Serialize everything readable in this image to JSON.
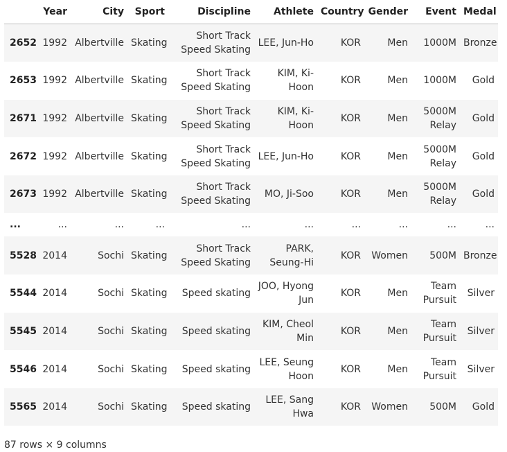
{
  "table": {
    "columns": [
      "",
      "Year",
      "City",
      "Sport",
      "Discipline",
      "Athlete",
      "Country",
      "Gender",
      "Event",
      "Medal"
    ],
    "rows": [
      [
        "2652",
        "1992",
        "Albertville",
        "Skating",
        "Short Track Speed Skating",
        "LEE, Jun-Ho",
        "KOR",
        "Men",
        "1000M",
        "Bronze"
      ],
      [
        "2653",
        "1992",
        "Albertville",
        "Skating",
        "Short Track Speed Skating",
        "KIM, Ki-Hoon",
        "KOR",
        "Men",
        "1000M",
        "Gold"
      ],
      [
        "2671",
        "1992",
        "Albertville",
        "Skating",
        "Short Track Speed Skating",
        "KIM, Ki-Hoon",
        "KOR",
        "Men",
        "5000M Relay",
        "Gold"
      ],
      [
        "2672",
        "1992",
        "Albertville",
        "Skating",
        "Short Track Speed Skating",
        "LEE, Jun-Ho",
        "KOR",
        "Men",
        "5000M Relay",
        "Gold"
      ],
      [
        "2673",
        "1992",
        "Albertville",
        "Skating",
        "Short Track Speed Skating",
        "MO, Ji-Soo",
        "KOR",
        "Men",
        "5000M Relay",
        "Gold"
      ],
      [
        "...",
        "...",
        "...",
        "...",
        "...",
        "...",
        "...",
        "...",
        "...",
        "..."
      ],
      [
        "5528",
        "2014",
        "Sochi",
        "Skating",
        "Short Track Speed Skating",
        "PARK, Seung-Hi",
        "KOR",
        "Women",
        "500M",
        "Bronze"
      ],
      [
        "5544",
        "2014",
        "Sochi",
        "Skating",
        "Speed skating",
        "JOO, Hyong Jun",
        "KOR",
        "Men",
        "Team Pursuit",
        "Silver"
      ],
      [
        "5545",
        "2014",
        "Sochi",
        "Skating",
        "Speed skating",
        "KIM, Cheol Min",
        "KOR",
        "Men",
        "Team Pursuit",
        "Silver"
      ],
      [
        "5546",
        "2014",
        "Sochi",
        "Skating",
        "Speed skating",
        "LEE, Seung Hoon",
        "KOR",
        "Men",
        "Team Pursuit",
        "Silver"
      ],
      [
        "5565",
        "2014",
        "Sochi",
        "Skating",
        "Speed skating",
        "LEE, Sang Hwa",
        "KOR",
        "Women",
        "500M",
        "Gold"
      ]
    ]
  },
  "footer": {
    "summary": "87 rows × 9 columns"
  }
}
